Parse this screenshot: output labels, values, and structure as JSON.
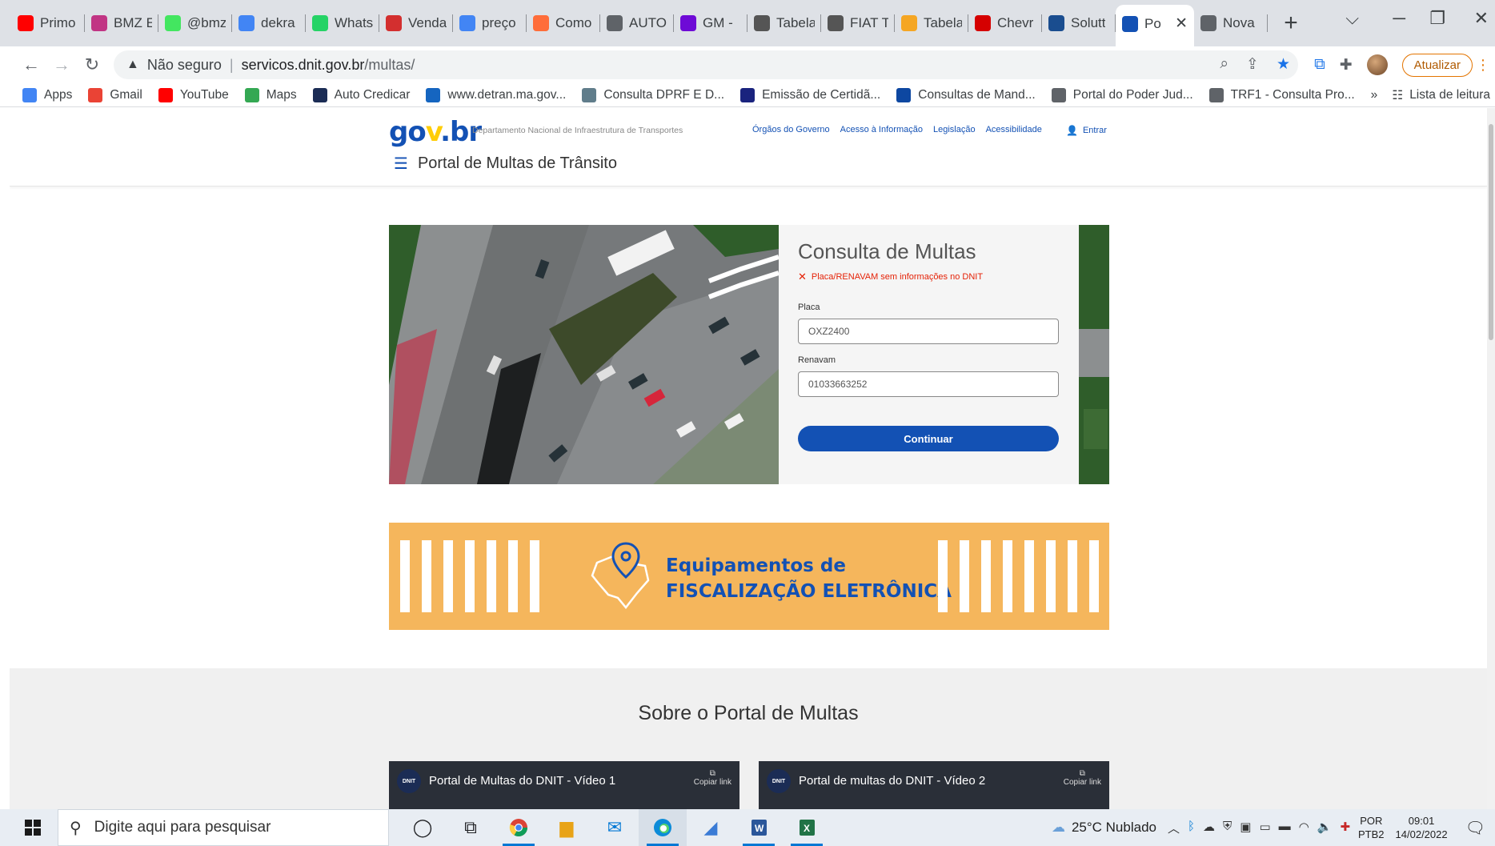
{
  "browser": {
    "tabs": [
      {
        "label": "Primo",
        "icon": "youtube-icon",
        "color": "#ff0000"
      },
      {
        "label": "BMZ E",
        "icon": "instagram-icon",
        "color": "#c13584"
      },
      {
        "label": "@bmz",
        "icon": "linktree-icon",
        "color": "#43e660"
      },
      {
        "label": "dekra",
        "icon": "google-icon",
        "color": "#4285f4"
      },
      {
        "label": "Whats",
        "icon": "whatsapp-icon",
        "color": "#25d366"
      },
      {
        "label": "Venda",
        "icon": "site-icon",
        "color": "#d32f2f"
      },
      {
        "label": "preço",
        "icon": "google-icon",
        "color": "#4285f4"
      },
      {
        "label": "Como",
        "icon": "s-icon",
        "color": "#ff6d3a"
      },
      {
        "label": "AUTO",
        "icon": "globe-icon",
        "color": "#5f6368"
      },
      {
        "label": "GM -",
        "icon": "olx-icon",
        "color": "#6e0ad6"
      },
      {
        "label": "Tabela",
        "icon": "fipe-icon",
        "color": "#555555"
      },
      {
        "label": "FIAT T",
        "icon": "car-icon",
        "color": "#555555"
      },
      {
        "label": "Tabela",
        "icon": "chart-icon",
        "color": "#f5a623"
      },
      {
        "label": "Chevr",
        "icon": "chevrolet-icon",
        "color": "#d50000"
      },
      {
        "label": "Solutt",
        "icon": "s-icon",
        "color": "#1a4d8f"
      },
      {
        "label": "Po",
        "icon": "gov-icon",
        "color": "#1351b4"
      },
      {
        "label": "Nova",
        "icon": "chrome-icon",
        "color": "#5f6368"
      }
    ],
    "active_tab_index": 15,
    "address": {
      "security": "Não seguro",
      "host": "servicos.dnit.gov.br",
      "path": "/multas/"
    },
    "update_label": "Atualizar",
    "bookmarks": [
      {
        "label": "Apps",
        "icon": "apps-icon"
      },
      {
        "label": "Gmail",
        "icon": "gmail-icon"
      },
      {
        "label": "YouTube",
        "icon": "youtube-icon"
      },
      {
        "label": "Maps",
        "icon": "maps-icon"
      },
      {
        "label": "Auto Credicar",
        "icon": "triangle-icon"
      },
      {
        "label": "www.detran.ma.gov...",
        "icon": "detran-icon"
      },
      {
        "label": "Consulta DPRF E D...",
        "icon": "prf-icon"
      },
      {
        "label": "Emissão de Certidã...",
        "icon": "certidao-icon"
      },
      {
        "label": "Consultas de Mand...",
        "icon": "cnj-icon"
      },
      {
        "label": "Portal do Poder Jud...",
        "icon": "globe-icon"
      },
      {
        "label": "TRF1 - Consulta Pro...",
        "icon": "globe-icon"
      }
    ],
    "reading_list": "Lista de leitura",
    "more_bookmarks": "»"
  },
  "site": {
    "logo": {
      "g": "go",
      "v": "v",
      "b": ".br"
    },
    "department": "Departamento Nacional de Infraestrutura de Transportes",
    "top_links": [
      "Órgãos do Governo",
      "Acesso à Informação",
      "Legislação",
      "Acessibilidade"
    ],
    "login_label": "Entrar",
    "portal_title": "Portal de Multas de Trânsito",
    "form": {
      "title": "Consulta de Multas",
      "error": "Placa/RENAVAM sem informações no DNIT",
      "placa_label": "Placa",
      "placa_value": "OXZ2400",
      "renavam_label": "Renavam",
      "renavam_value": "01033663252",
      "submit_label": "Continuar"
    },
    "banner": {
      "line1": "Equipamentos de",
      "line2": "FISCALIZAÇÃO ELETRÔNICA"
    },
    "about_title": "Sobre o Portal de Multas",
    "videos": [
      {
        "title": "Portal de Multas do DNIT - Vídeo 1",
        "copy": "Copiar link"
      },
      {
        "title": "Portal de multas do DNIT - Vídeo 2",
        "copy": "Copiar link"
      }
    ]
  },
  "taskbar": {
    "search_placeholder": "Digite aqui para pesquisar",
    "weather": "25°C  Nublado",
    "lang_line1": "POR",
    "lang_line2": "PTB2",
    "time": "09:01",
    "date": "14/02/2022"
  },
  "colors": {
    "gov_blue": "#1351b4",
    "gov_yellow": "#ffcd07",
    "error_red": "#e52207",
    "banner_orange": "#f5b65c"
  }
}
